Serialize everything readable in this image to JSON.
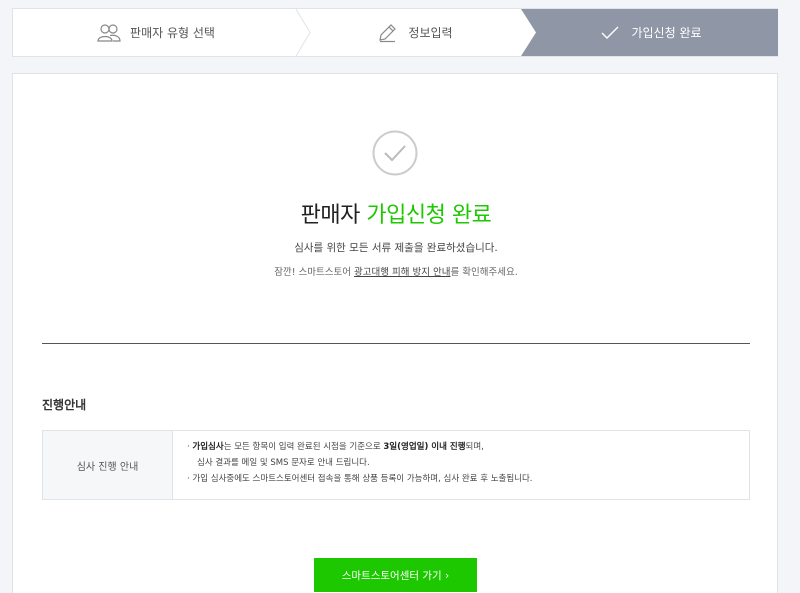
{
  "steps": [
    {
      "label": "판매자 유형 선택",
      "icon": "users-icon",
      "state": "done"
    },
    {
      "label": "정보입력",
      "icon": "pencil-icon",
      "state": "done"
    },
    {
      "label": "가입신청 완료",
      "icon": "check-icon",
      "state": "active"
    }
  ],
  "main": {
    "headline_prefix": "판매자 ",
    "headline_highlight": "가입신청 완료",
    "desc1": "심사를 위한 모든 서류 제출을 완료하셨습니다.",
    "desc2_prefix": "잠깐! 스마트스토어 ",
    "desc2_link": "광고대행 피해 방지 안내",
    "desc2_suffix": "를 확인해주세요."
  },
  "progress": {
    "title": "진행안내",
    "label": "심사 진행 안내",
    "line1_bullet": "· ",
    "line1_bold1": "가입심사",
    "line1_mid": "는 모든 항목이 입력 완료된 시점을 기준으로 ",
    "line1_bold2": "3일(영업일) 이내 진행",
    "line1_end": "되며,",
    "line2": "심사 결과를 메일 및 SMS 문자로 안내 드립니다.",
    "line3": "· 가입 심사중에도 스마트스토어센터 접속을 통해 상품 등록이 가능하며, 심사 완료 후 노출됩니다."
  },
  "cta": {
    "label": "스마트스토어센터 가기 ›"
  },
  "colors": {
    "accent": "#1ec800",
    "active_step": "#8f97a7"
  }
}
